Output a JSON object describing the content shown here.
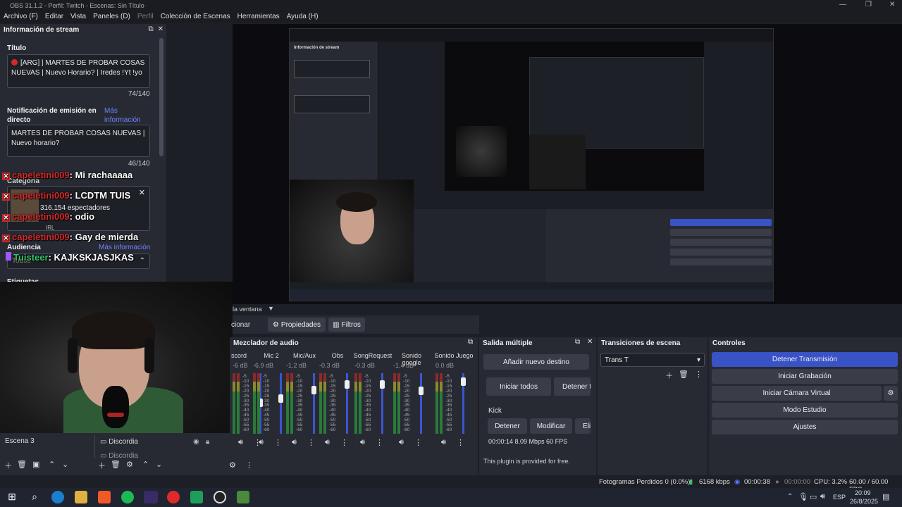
{
  "window": {
    "title": "OBS 31.1.2 - Perfil: Twitch - Escenas: Sin Título",
    "controls": [
      "—",
      "❐",
      "✕"
    ]
  },
  "menu": [
    {
      "label": "Archivo (F)",
      "dim": false
    },
    {
      "label": "Editar",
      "dim": false
    },
    {
      "label": "Vista",
      "dim": false
    },
    {
      "label": "Paneles (D)",
      "dim": false
    },
    {
      "label": "Perfil",
      "dim": true
    },
    {
      "label": "Colección de Escenas",
      "dim": false
    },
    {
      "label": "Herramientas",
      "dim": false
    },
    {
      "label": "Ayuda (H)",
      "dim": false
    }
  ],
  "stream_info": {
    "header": "Información de stream",
    "title_label": "Título",
    "title_value": "[ARG] | MARTES DE PROBAR COSAS NUEVAS | Nuevo Horario? | Iredes !Yt !yo",
    "title_count": "74/140",
    "notif_label": "Notificación de emisión en directo",
    "more_info": "Más información",
    "notif_value": "MARTES DE PROBAR COSAS NUEVAS | Nuevo horario?",
    "notif_count": "46/140",
    "category_label": "Categoría",
    "category_viewers": "316.154 espectadores",
    "category_tag": "IRL",
    "audience_label": "Audiencia",
    "audience_more": "Más información",
    "audience_value": "Todos",
    "tags_label": "Etiquetas"
  },
  "chat": [
    {
      "name": "capeletini009",
      "text": ": Mi rachaaaaa"
    },
    {
      "name": "capeletini009",
      "text": ": LCDTM TUIS"
    },
    {
      "name": "capeletini009",
      "text": ": odio"
    },
    {
      "name": "capeletini009",
      "text": ": Gay de mierda"
    },
    {
      "name": "Tuisteer",
      "text": ": KAJKSKJASJKAS"
    }
  ],
  "preview_bar": {
    "fit_label": "la ventana",
    "sources_tab": "cionar",
    "properties": "Propiedades",
    "filters": "Filtros"
  },
  "scenes": {
    "current": "Escena 3"
  },
  "sources": {
    "items": [
      "Discordia",
      "Discordia"
    ]
  },
  "mixer": {
    "header": "Mezclador de audio",
    "scale": [
      "-5",
      "-10",
      "-15",
      "-20",
      "-25",
      "-30",
      "-35",
      "-40",
      "-45",
      "-50",
      "-55",
      "-60"
    ],
    "channels": [
      {
        "name": "scord",
        "db": "-6 dB",
        "level": 0.55
      },
      {
        "name": "Mic 2",
        "db": "-6.9 dB",
        "level": 0.62
      },
      {
        "name": "Mic/Aux",
        "db": "-1.2 dB",
        "level": 0.78
      },
      {
        "name": "Obs",
        "db": "-0.3 dB",
        "level": 0.88
      },
      {
        "name": "SongRequest",
        "db": "-0.3 dB",
        "level": 0.88
      },
      {
        "name": "Sonido google",
        "db": "-1.4 dB",
        "level": 0.76
      },
      {
        "name": "Sonido Juego",
        "db": "0.0 dB",
        "level": 0.92
      }
    ]
  },
  "multi_output": {
    "header": "Salida múltiple",
    "add_dest": "Añadir nuevo destino",
    "start_all": "Iniciar todos",
    "stop_all": "Detener t",
    "platform": "Kick",
    "stop": "Detener",
    "modify": "Modificar",
    "delete_partial": "Eli",
    "stats": "00:00:14  8.09 Mbps  60 FPS",
    "footer": "This plugin is provided for free."
  },
  "transitions": {
    "header": "Transiciones de escena",
    "selected": "Trans T"
  },
  "controls": {
    "header": "Controles",
    "stop_stream": "Detener Transmisión",
    "start_rec": "Iniciar Grabación",
    "start_vcam": "Iniciar Cámara Virtual",
    "studio": "Modo Estudio",
    "settings": "Ajustes"
  },
  "status": {
    "dropped": "Fotogramas Perdidos 0 (0.0%)",
    "kbps": "6168 kbps",
    "stream_time": "00:00:38",
    "rec_time": "00:00:00",
    "cpu": "CPU: 3.2%",
    "fps": "60.00 / 60.00 FPS"
  },
  "taskbar": {
    "time": "20:09",
    "date": "26/8/2025",
    "lang": "ESP",
    "apps": [
      "start-icon",
      "search-icon",
      "edge-icon",
      "explorer-icon",
      "brave-icon",
      "spotify-icon",
      "kick-icon",
      "opera-icon",
      "excel-icon",
      "obs-icon",
      "game-icon"
    ]
  },
  "colors": {
    "accent": "#3952c6",
    "chat_name": "#d42a2a",
    "link": "#6f83ff"
  }
}
